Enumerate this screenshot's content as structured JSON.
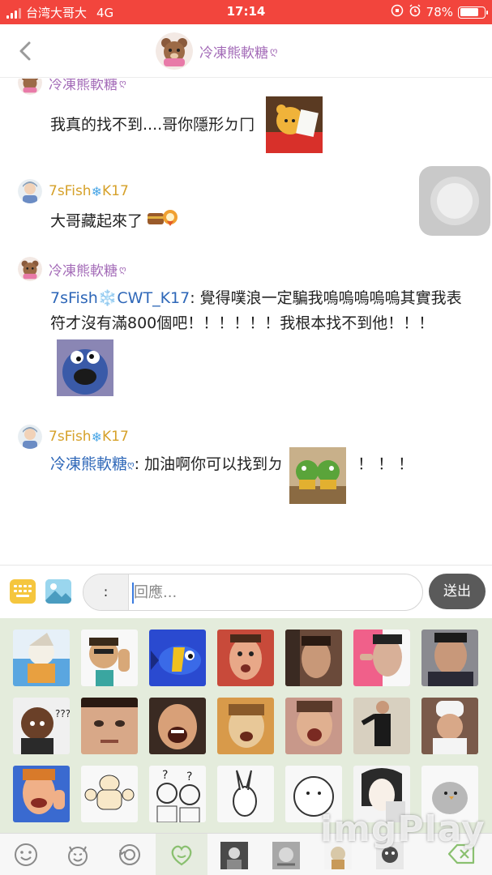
{
  "status_bar": {
    "carrier": "台湾大哥大",
    "network": "4G",
    "time": "17:14",
    "battery_percent": "78%",
    "battery_level": 0.78,
    "background": "#f2453d"
  },
  "header": {
    "title": "冷凍熊軟糖",
    "title_suffix_icon": "heart-ribbon-icon",
    "back_icon": "chevron-left-icon",
    "accent_color": "#a46cb8"
  },
  "messages": [
    {
      "sender": "冷凍熊軟糖",
      "text": "我真的找不到....哥你隱形ㄉ冂",
      "sticker": "winnie-pooh-reading-sticker"
    },
    {
      "sender_name": "7sFish",
      "sender_badge": "K17",
      "text": "大哥藏起來了",
      "emoji": "treasure-emoji"
    },
    {
      "sender": "冷凍熊軟糖",
      "mention": "7sFish❄️CWT_K17",
      "text": ": 覺得噗浪一定騙我嗚嗚嗚嗚嗚其實我表符才沒有滿800個吧！！！！！！我根本找不到他！！！",
      "sticker": "cookie-monster-sticker"
    },
    {
      "sender_name": "7sFish",
      "sender_badge": "K17",
      "mention": "冷凍熊軟糖",
      "text": ": 加油啊你可以找到ㄉ",
      "trailing_text": "！！！",
      "sticker": "frogs-cheering-sticker"
    }
  ],
  "composer": {
    "prefix": ":",
    "placeholder": "回應...",
    "send_label": "送出",
    "keyboard_icon": "keyboard-icon",
    "image_icon": "image-icon"
  },
  "sticker_panel": {
    "background": "#e4ecdc",
    "stickers": [
      "cartoon-wizard-sticker",
      "waving-guy-sticker",
      "blue-fish-sticker",
      "shocked-wrestler-sticker",
      "crying-man-sticker",
      "pointing-man-sticker",
      "sweating-man-sticker",
      "confused-guy-sticker",
      "closeup-face-sticker",
      "laughing-face-sticker",
      "shouting-man-sticker",
      "screaming-man-sticker",
      "dancing-man-sticker",
      "chef-sticker",
      "happy-host-sticker",
      "muscle-cat-sticker",
      "confused-couple-sticker",
      "white-rabbit-sticker",
      "round-blob-sticker",
      "manga-girl-sticker",
      "gray-bird-sticker"
    ]
  },
  "tabs": [
    {
      "icon": "smiley-icon",
      "active": false
    },
    {
      "icon": "devil-face-icon",
      "active": false
    },
    {
      "icon": "recent-icon",
      "active": false
    },
    {
      "icon": "heart-face-icon",
      "active": true
    },
    {
      "icon": "custom-pack-1-icon",
      "active": false
    },
    {
      "icon": "custom-pack-2-icon",
      "active": false
    },
    {
      "icon": "custom-pack-3-icon",
      "active": false
    },
    {
      "icon": "custom-pack-4-icon",
      "active": false
    },
    {
      "icon": "backspace-icon",
      "active": false
    }
  ],
  "watermark": "imgPlay"
}
